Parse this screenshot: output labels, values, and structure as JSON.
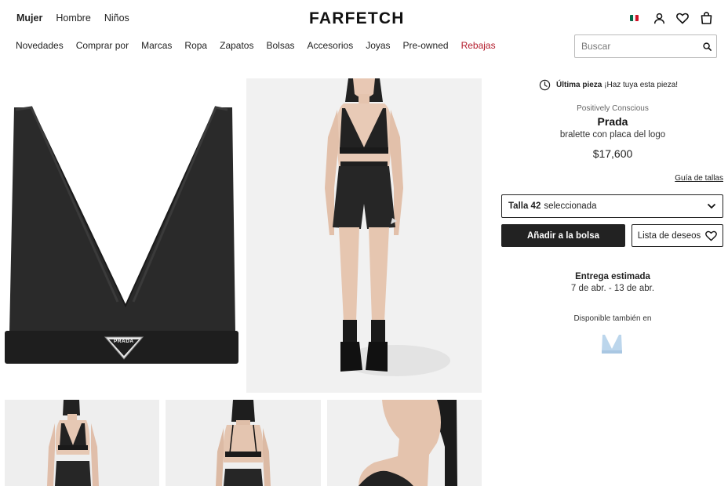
{
  "header": {
    "gender_tabs": [
      "Mujer",
      "Hombre",
      "Niños"
    ],
    "logo": "FARFETCH"
  },
  "nav": {
    "items": [
      "Novedades",
      "Comprar por",
      "Marcas",
      "Ropa",
      "Zapatos",
      "Bolsas",
      "Accesorios",
      "Joyas",
      "Pre-owned"
    ],
    "sale": "Rebajas",
    "sale_color": "#b31b2b"
  },
  "search": {
    "placeholder": "Buscar"
  },
  "product": {
    "last_piece_bold": "Última pieza",
    "last_piece_text": " ¡Haz tuya esta pieza!",
    "eco_label": "Positively Conscious",
    "brand": "Prada",
    "name": "bralette con placa del logo",
    "price": "$17,600",
    "logo_plate_text": "PRADA"
  },
  "sizing": {
    "guide_label": "Guía de tallas",
    "selected_prefix": "Talla 42",
    "selected_suffix": "seleccionada"
  },
  "actions": {
    "add_to_bag": "Añadir a la bolsa",
    "wishlist": "Lista de deseos"
  },
  "delivery": {
    "title": "Entrega estimada",
    "dates": "7 de abr. - 13 de abr."
  },
  "variants": {
    "label": "Disponible también en",
    "swatch_color": "#bcd6ec"
  },
  "icons": [
    "flag-icon",
    "account-icon",
    "heart-icon",
    "bag-icon",
    "search-icon",
    "clock-icon",
    "chevron-down-icon"
  ]
}
